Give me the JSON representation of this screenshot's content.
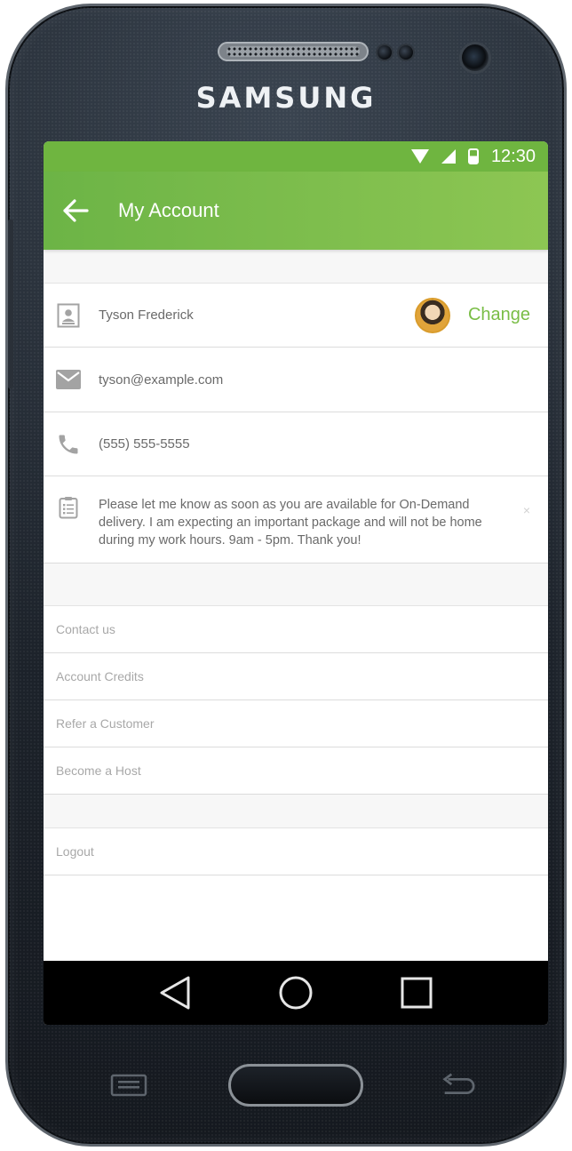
{
  "device": {
    "brand": "SAMSUNG",
    "icons": {
      "earpiece": "earpiece-grille",
      "camera": "front-camera",
      "home": "home-key",
      "menu": "menu-key",
      "back": "back-key"
    }
  },
  "status_bar": {
    "time": "12:30",
    "icons": [
      "wifi-icon",
      "signal-icon",
      "battery-icon"
    ],
    "color": "#6fb540"
  },
  "app_bar": {
    "title": "My Account",
    "back_icon": "arrow-left-icon",
    "color_start": "#6cb446",
    "color_end": "#8dc653"
  },
  "profile": {
    "name": "Tyson Frederick",
    "email": "tyson@example.com",
    "phone": "(555) 555-5555",
    "note": "Please let me know as soon as you are available for On-Demand delivery.  I am expecting an important package and will not be home during my work hours.  9am - 5pm.  Thank you!",
    "change_label": "Change",
    "note_close": "×",
    "accent": "#79bd45"
  },
  "menu": {
    "items": [
      {
        "label": "Contact us"
      },
      {
        "label": "Account Credits"
      },
      {
        "label": "Refer a Customer"
      },
      {
        "label": "Become a Host"
      }
    ],
    "logout": "Logout"
  },
  "nav": {
    "back": "triangle-back-icon",
    "home": "circle-home-icon",
    "recents": "square-recents-icon"
  }
}
